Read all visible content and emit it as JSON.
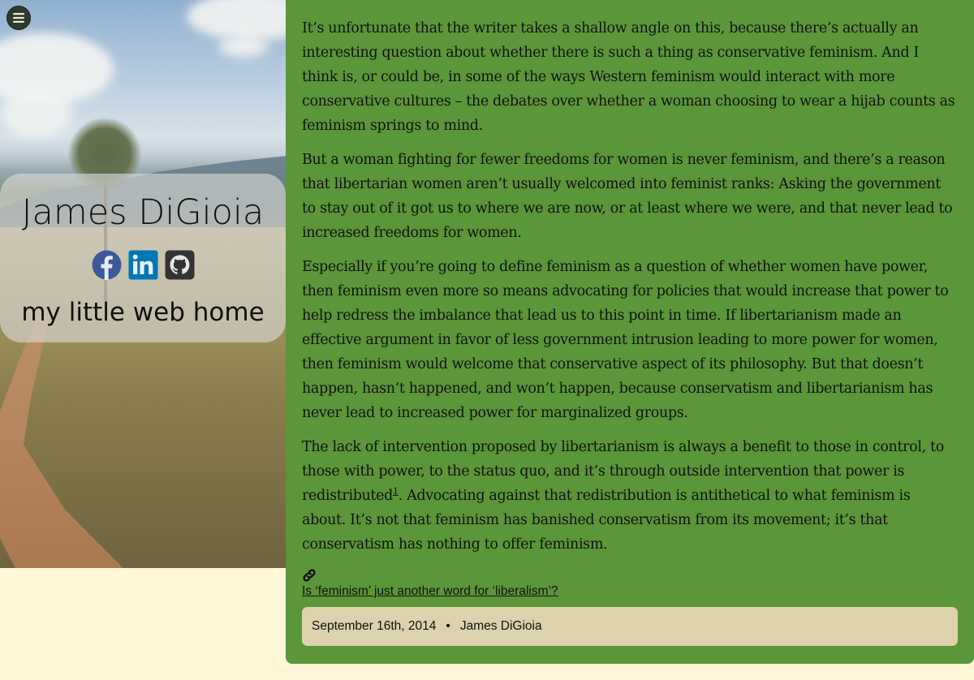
{
  "sidebar": {
    "menu_icon": "hamburger-menu-icon",
    "site_name": "James DiGioia",
    "tagline": "my little web home",
    "social": [
      {
        "name": "facebook-icon",
        "color": "#3b5998"
      },
      {
        "name": "linkedin-icon",
        "color": "#0077b5"
      },
      {
        "name": "github-icon",
        "color": "#333333"
      }
    ]
  },
  "article": {
    "paragraphs": [
      {
        "text": "It’s unfortunate that the writer takes a shallow angle on this, because there’s actually an interesting question about whether there is such a thing as conservative feminism. And I think is, or could be, in some of the ways Western feminism would interact with more conservative cultures – the debates over whether a woman choosing to wear a hijab counts as feminism springs to mind."
      },
      {
        "text": "But a woman fighting for fewer freedoms for women is never feminism, and there’s a reason that libertarian women aren’t usually welcomed into feminist ranks: Asking the government to stay out of it got us to where we are now, or at least where we were, and that never lead to increased freedoms for women."
      },
      {
        "text": "Especially if you’re going to define feminism as a question of whether women have power, then feminism even more so means advocating for policies that would increase that power to help redress the imbalance that lead us to this point in time. If libertarianism made an effective argument in favor of less government intrusion leading to more power for women, then feminism would welcome that conservative aspect of its philosophy. But that doesn’t happen, hasn’t happened, and won’t happen, because conservatism and libertarianism has never lead to increased power for marginalized groups."
      }
    ],
    "last_paragraph": {
      "before": "The lack of intervention proposed by libertarianism is always a benefit to those in control, to those with power, to the status quo, and it’s through outside intervention that power is redistributed",
      "footnote": "1",
      "after": ". Advocating against that redistribution is antithetical to what feminism is about. It’s not that feminism has banished conservatism from its movement; it’s that conservatism has nothing to offer feminism."
    },
    "permalink_icon": "link-icon",
    "source_link": "Is ‘feminism’ just another word for ‘liberalism’?",
    "meta": {
      "date": "September 16th, 2014",
      "separator": "•",
      "author": "James DiGioia"
    }
  },
  "colors": {
    "page_background": "#fff7d6",
    "article_background": "#5b963a",
    "meta_background": "#dcd2ab"
  }
}
